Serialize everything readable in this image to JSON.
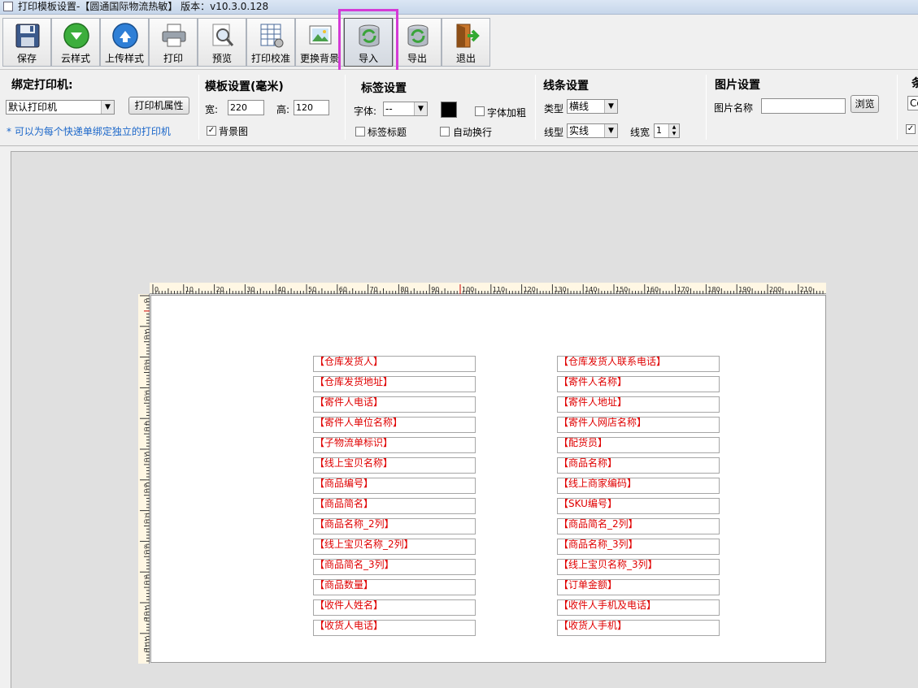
{
  "window": {
    "title": "打印模板设置-【圆通国际物流热敏】 版本：v10.3.0.128"
  },
  "toolbar": {
    "buttons": [
      {
        "label": "保存",
        "icon": "save-disk-icon"
      },
      {
        "label": "云样式",
        "icon": "cloud-download-icon"
      },
      {
        "label": "上传样式",
        "icon": "upload-arrow-icon"
      },
      {
        "label": "打印",
        "icon": "printer-icon"
      },
      {
        "label": "预览",
        "icon": "preview-magnifier-icon"
      },
      {
        "label": "打印校准",
        "icon": "calibration-grid-icon"
      },
      {
        "label": "更换背景",
        "icon": "picture-icon"
      },
      {
        "label": "导入",
        "icon": "database-refresh-icon"
      },
      {
        "label": "导出",
        "icon": "database-export-icon"
      },
      {
        "label": "退出",
        "icon": "exit-door-icon"
      }
    ]
  },
  "printer": {
    "title": "绑定打印机:",
    "selected": "默认打印机",
    "props_button": "打印机属性",
    "hint": "* 可以为每个快递单绑定独立的打印机"
  },
  "template": {
    "title": "模板设置(毫米)",
    "width_label": "宽:",
    "width_value": "220",
    "height_label": "高:",
    "height_value": "120",
    "background_label": "背景图",
    "background_checked": true
  },
  "label": {
    "title": "标签设置",
    "font_label": "字体:",
    "font_value": "--",
    "color": "#000000",
    "bold_label": "字体加粗",
    "title_check_label": "标签标题",
    "autowrap_label": "自动换行"
  },
  "line": {
    "title": "线条设置",
    "type_label": "类型",
    "type_value": "横线",
    "style_label": "线型",
    "style_value": "实线",
    "width_label": "线宽",
    "width_value": "1"
  },
  "image": {
    "title": "图片设置",
    "name_label": "图片名称",
    "name_value": "",
    "browse_button": "浏览"
  },
  "extra": {
    "title_fragment": "条",
    "select_fragment": "Co"
  },
  "ruler": {
    "top_labels": [
      "0",
      "10",
      "20",
      "30",
      "40",
      "50",
      "60",
      "70",
      "80",
      "90",
      "100",
      "110",
      "120",
      "130",
      "140",
      "150",
      "160",
      "170",
      "180",
      "190",
      "200",
      "210"
    ],
    "left_labels": [
      "0",
      "10",
      "20",
      "30",
      "40",
      "50",
      "60",
      "70",
      "80",
      "90",
      "100",
      "110"
    ]
  },
  "fields": {
    "left": [
      "【仓库发货人】",
      "【仓库发货地址】",
      "【寄件人电话】",
      "【寄件人单位名称】",
      "【子物流单标识】",
      "【线上宝贝名称】",
      "【商品编号】",
      "【商品简名】",
      "【商品名称_2列】",
      "【线上宝贝名称_2列】",
      "【商品简名_3列】",
      "【商品数量】",
      "【收件人姓名】",
      "【收货人电话】"
    ],
    "right": [
      "【仓库发货人联系电话】",
      "【寄件人名称】",
      "【寄件人地址】",
      "【寄件人网店名称】",
      "【配货员】",
      "【商品名称】",
      "【线上商家编码】",
      "【SKU编号】",
      "【商品简名_2列】",
      "【商品名称_3列】",
      "【线上宝贝名称_3列】",
      "【订单金额】",
      "【收件人手机及电话】",
      "【收货人手机】"
    ]
  },
  "colors": {
    "field_text": "#e00000",
    "highlight": "#d43ad6",
    "hint_text": "#1a66c9"
  }
}
